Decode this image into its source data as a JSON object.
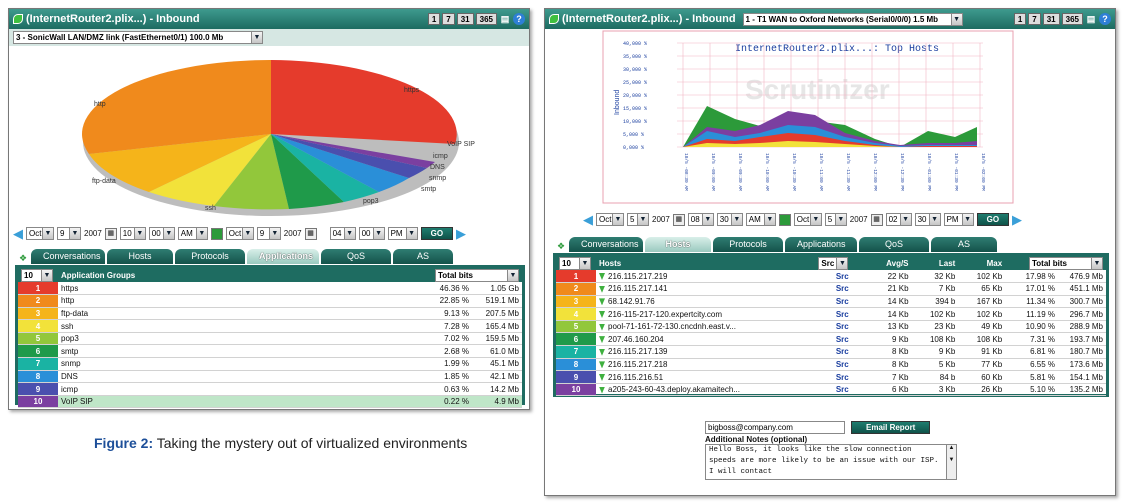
{
  "left": {
    "title": "(InternetRouter2.plix...) - Inbound",
    "range_buttons": [
      "1",
      "7",
      "31",
      "365"
    ],
    "iface_select": "3 - SonicWall LAN/DMZ link (FastEthernet0/1) 100.0 Mb",
    "pie_labels": [
      "https",
      "http",
      "ftp-data",
      "ssh",
      "pop3",
      "smtp",
      "snmp",
      "DNS",
      "icmp",
      "VoIP SIP"
    ],
    "time": {
      "m1": "Oct",
      "d1": "9",
      "y1": "2007",
      "h1": "10",
      "mi1": "00",
      "ap1": "AM",
      "m2": "Oct",
      "d2": "9",
      "y2": "2007",
      "h2": "04",
      "mi2": "00",
      "ap2": "PM",
      "go": "GO"
    },
    "tabs": [
      "Conversations",
      "Hosts",
      "Protocols",
      "Applications",
      "QoS",
      "AS"
    ],
    "table": {
      "count": "10",
      "col1": "Application Groups",
      "col2": "Total bits",
      "rows": [
        {
          "n": "1",
          "name": "https",
          "pct": "46.36 %",
          "val": "1.05 Gb",
          "c": "#e53b2c"
        },
        {
          "n": "2",
          "name": "http",
          "pct": "22.85 %",
          "val": "519.1 Mb",
          "c": "#f08a1c"
        },
        {
          "n": "3",
          "name": "ftp-data",
          "pct": "9.13 %",
          "val": "207.5 Mb",
          "c": "#f5b41a"
        },
        {
          "n": "4",
          "name": "ssh",
          "pct": "7.28 %",
          "val": "165.4 Mb",
          "c": "#f2e23a"
        },
        {
          "n": "5",
          "name": "pop3",
          "pct": "7.02 %",
          "val": "159.5 Mb",
          "c": "#92c73b"
        },
        {
          "n": "6",
          "name": "smtp",
          "pct": "2.68 %",
          "val": "61.0 Mb",
          "c": "#1f9a4a"
        },
        {
          "n": "7",
          "name": "snmp",
          "pct": "1.99 %",
          "val": "45.1 Mb",
          "c": "#1ab3a3"
        },
        {
          "n": "8",
          "name": "DNS",
          "pct": "1.85 %",
          "val": "42.1 Mb",
          "c": "#2a8fd8"
        },
        {
          "n": "9",
          "name": "icmp",
          "pct": "0.63 %",
          "val": "14.2 Mb",
          "c": "#4a4fae"
        },
        {
          "n": "10",
          "name": "VoIP SIP",
          "pct": "0.22 %",
          "val": "4.9 Mb",
          "c": "#7b3fa0"
        }
      ]
    }
  },
  "caption": {
    "prefix": "Figure 2:",
    "text": " Taking the mystery out of virtualized environments"
  },
  "right": {
    "title": "(InternetRouter2.plix...) - Inbound",
    "iface_select": "1 - T1 WAN to Oxford Networks (Serial0/0/0) 1.5 Mb",
    "range_buttons": [
      "1",
      "7",
      "31",
      "365"
    ],
    "chart_title": "InternetRouter2.plix...: Top Hosts",
    "ylabel": "Inbound",
    "yticks": [
      "40,000 %",
      "35,000 %",
      "30,000 %",
      "25,000 %",
      "20,000 %",
      "15,000 %",
      "10,000 %",
      "5,000 %",
      "0,000 %"
    ],
    "xticks": [
      "10/5 -08:30 AM",
      "10/5 -09:00 AM",
      "10/5 -09:30 AM",
      "10/5 -10:00 AM",
      "10/5 -10:30 AM",
      "10/5 -11:00 AM",
      "10/5 -11:30 AM",
      "10/5 -12:00 PM",
      "10/5 -12:30 PM",
      "10/5 -01:00 PM",
      "10/5 -01:30 PM",
      "10/5 -02:00 PM"
    ],
    "watermark": "Scrutinizer",
    "time": {
      "m1": "Oct",
      "d1": "5",
      "y1": "2007",
      "h1": "08",
      "mi1": "30",
      "ap1": "AM",
      "m2": "Oct",
      "d2": "5",
      "y2": "2007",
      "h2": "02",
      "mi2": "30",
      "ap2": "PM",
      "go": "GO"
    },
    "tabs": [
      "Conversations",
      "Hosts",
      "Protocols",
      "Applications",
      "QoS",
      "AS"
    ],
    "table": {
      "count": "10",
      "col1": "Hosts",
      "col_src": "Src",
      "col_avg": "Avg/S",
      "col_last": "Last",
      "col_max": "Max",
      "col_tot": "Total bits",
      "rows": [
        {
          "n": "1",
          "host": "216.115.217.219",
          "src": "Src",
          "avg": "22 Kb",
          "last": "32 Kb",
          "max": "102 Kb",
          "pct": "17.98 %",
          "tot": "476.9 Mb",
          "c": "#e53b2c"
        },
        {
          "n": "2",
          "host": "216.115.217.141",
          "src": "Src",
          "avg": "21 Kb",
          "last": "7 Kb",
          "max": "65 Kb",
          "pct": "17.01 %",
          "tot": "451.1 Mb",
          "c": "#f08a1c"
        },
        {
          "n": "3",
          "host": "68.142.91.76",
          "src": "Src",
          "avg": "14 Kb",
          "last": "394 b",
          "max": "167 Kb",
          "pct": "11.34 %",
          "tot": "300.7 Mb",
          "c": "#f5b41a"
        },
        {
          "n": "4",
          "host": "216-115-217-120.expertcity.com",
          "src": "Src",
          "avg": "14 Kb",
          "last": "102 Kb",
          "max": "102 Kb",
          "pct": "11.19 %",
          "tot": "296.7 Mb",
          "c": "#f2e23a"
        },
        {
          "n": "5",
          "host": "pool-71-161-72-130.cncdnh.east.v...",
          "src": "Src",
          "avg": "13 Kb",
          "last": "23 Kb",
          "max": "49 Kb",
          "pct": "10.90 %",
          "tot": "288.9 Mb",
          "c": "#92c73b"
        },
        {
          "n": "6",
          "host": "207.46.160.204",
          "src": "Src",
          "avg": "9 Kb",
          "last": "108 Kb",
          "max": "108 Kb",
          "pct": "7.31 %",
          "tot": "193.7 Mb",
          "c": "#1f9a4a"
        },
        {
          "n": "7",
          "host": "216.115.217.139",
          "src": "Src",
          "avg": "8 Kb",
          "last": "9 Kb",
          "max": "91 Kb",
          "pct": "6.81 %",
          "tot": "180.7 Mb",
          "c": "#1ab3a3"
        },
        {
          "n": "8",
          "host": "216.115.217.218",
          "src": "Src",
          "avg": "8 Kb",
          "last": "5 Kb",
          "max": "77 Kb",
          "pct": "6.55 %",
          "tot": "173.6 Mb",
          "c": "#2a8fd8"
        },
        {
          "n": "9",
          "host": "216.115.216.51",
          "src": "Src",
          "avg": "7 Kb",
          "last": "84 b",
          "max": "60 Kb",
          "pct": "5.81 %",
          "tot": "154.1 Mb",
          "c": "#4a4fae"
        },
        {
          "n": "10",
          "host": "a205-243-60-43.deploy.akamaitech...",
          "src": "Src",
          "avg": "6 Kb",
          "last": "3 Kb",
          "max": "26 Kb",
          "pct": "5.10 %",
          "tot": "135.2 Mb",
          "c": "#7b3fa0"
        }
      ]
    },
    "email": {
      "value": "bigboss@company.com",
      "button": "Email Report",
      "notes_label": "Additional Notes (optional)",
      "notes": "Hello Boss, it looks like the slow connection speeds are more likely to be an issue with our ISP. I will contact"
    }
  }
}
